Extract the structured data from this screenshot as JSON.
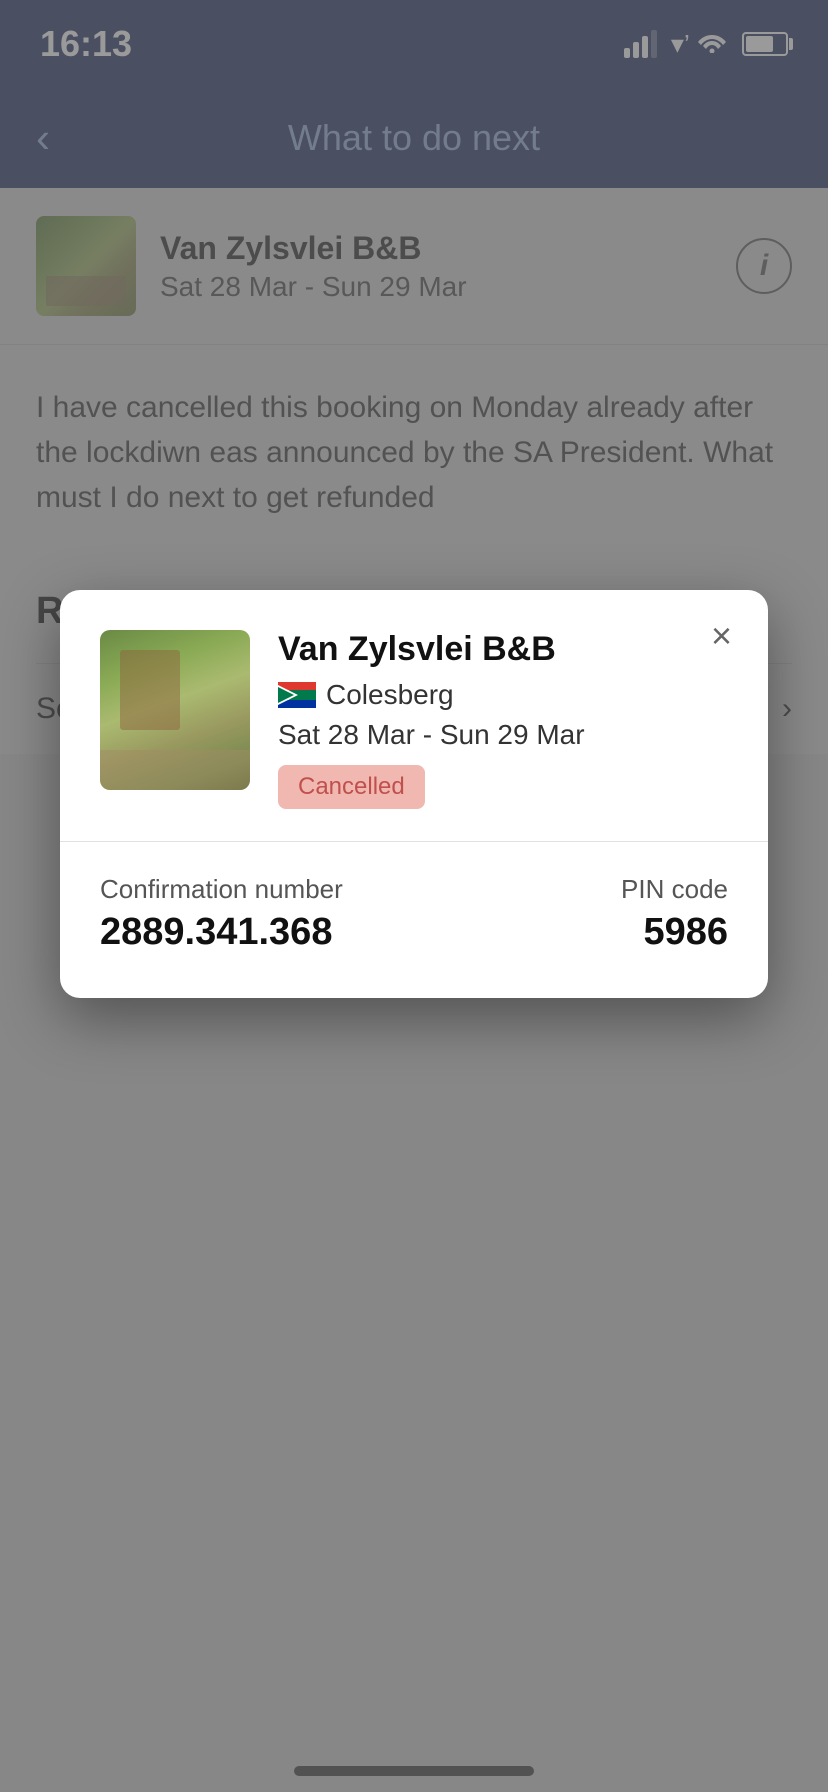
{
  "statusBar": {
    "time": "16:13"
  },
  "navBar": {
    "backLabel": "<",
    "title": "What to do next"
  },
  "propertyCard": {
    "name": "Van Zylsvlei B&B",
    "dates": "Sat 28 Mar - Sun 29 Mar",
    "infoLabel": "i"
  },
  "messageSection": {
    "text": "I have cancelled this booking on Monday already after the lockdiwn eas announced by the SA President. What must I do next to get  refunded"
  },
  "recommendedSection": {
    "title": "Recommended",
    "cancellationOption": {
      "label": "See cancellation options"
    }
  },
  "modal": {
    "propertyName": "Van Zylsvlei B&B",
    "location": "Colesberg",
    "dates": "Sat 28 Mar - Sun 29 Mar",
    "statusLabel": "Cancelled",
    "confirmationLabel": "Confirmation number",
    "confirmationNumber": "2889.341.368",
    "pinLabel": "PIN code",
    "pinCode": "5986",
    "closeLabel": "×"
  }
}
